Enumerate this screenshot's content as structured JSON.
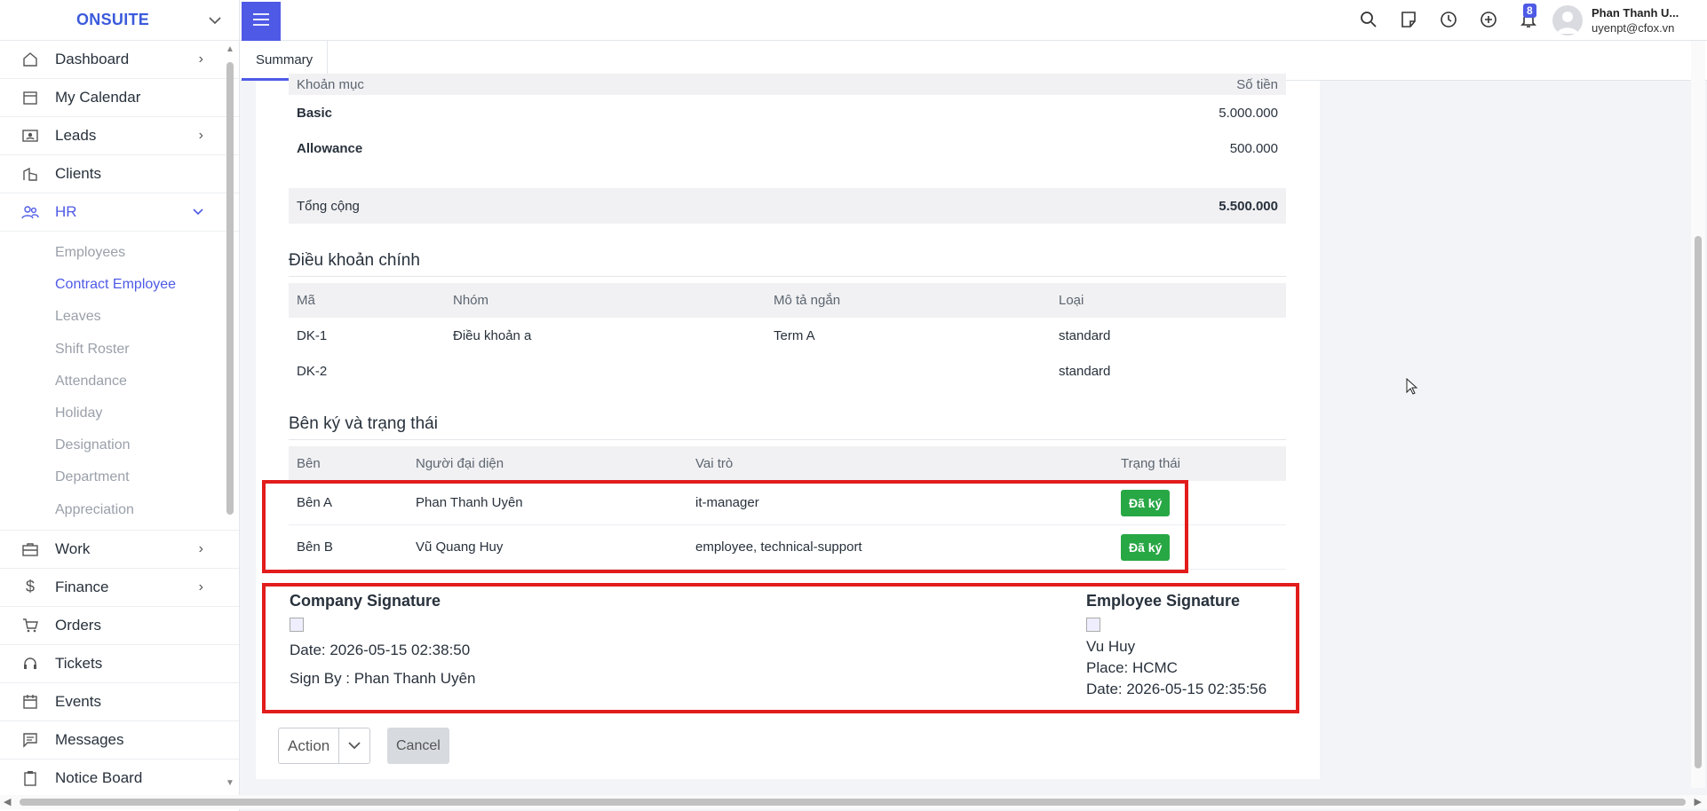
{
  "sidebar": {
    "brand": "ONSUITE",
    "items": [
      {
        "label": "Dashboard",
        "icon": "home-icon",
        "has_arrow": true
      },
      {
        "label": "My Calendar",
        "icon": "calendar-icon",
        "has_arrow": false
      },
      {
        "label": "Leads",
        "icon": "contact-card-icon",
        "has_arrow": true
      },
      {
        "label": "Clients",
        "icon": "building-icon",
        "has_arrow": false
      },
      {
        "label": "HR",
        "icon": "people-icon",
        "has_arrow": true,
        "expanded": true
      }
    ],
    "hr_submenu": [
      "Employees",
      "Contract Employee",
      "Leaves",
      "Shift Roster",
      "Attendance",
      "Holiday",
      "Designation",
      "Department",
      "Appreciation"
    ],
    "hr_active": "Contract Employee",
    "items_after": [
      {
        "label": "Work",
        "icon": "briefcase-icon",
        "has_arrow": true
      },
      {
        "label": "Finance",
        "icon": "dollar-icon",
        "has_arrow": true
      },
      {
        "label": "Orders",
        "icon": "cart-icon",
        "has_arrow": false
      },
      {
        "label": "Tickets",
        "icon": "headset-icon",
        "has_arrow": false
      },
      {
        "label": "Events",
        "icon": "calendar-event-icon",
        "has_arrow": false
      },
      {
        "label": "Messages",
        "icon": "message-icon",
        "has_arrow": false
      },
      {
        "label": "Notice Board",
        "icon": "clipboard-icon",
        "has_arrow": false
      }
    ]
  },
  "topbar": {
    "notification_count": "8",
    "user_name": "Phan Thanh U...",
    "user_email": "uyenpt@cfox.vn"
  },
  "tabs": {
    "summary": "Summary"
  },
  "salary": {
    "header_left": "Khoản mục",
    "header_right": "Số tiền",
    "rows": [
      {
        "label": "Basic",
        "amount": "5.000.000"
      },
      {
        "label": "Allowance",
        "amount": "500.000"
      }
    ],
    "total_label": "Tổng cộng",
    "total_amount": "5.500.000"
  },
  "terms": {
    "title": "Điều khoản chính",
    "headers": [
      "Mã",
      "Nhóm",
      "Mô tả ngắn",
      "Loại"
    ],
    "rows": [
      [
        "DK-1",
        "Điều khoản a",
        "Term A",
        "standard"
      ],
      [
        "DK-2",
        "",
        "",
        "standard"
      ]
    ]
  },
  "signers": {
    "title": "Bên ký và trạng thái",
    "headers": [
      "Bên",
      "Người đại diện",
      "Vai trò",
      "Trạng thái"
    ],
    "rows": [
      {
        "party": "Bên A",
        "rep": "Phan Thanh Uyên",
        "role": "it-manager",
        "status": "Đã ký"
      },
      {
        "party": "Bên B",
        "rep": "Vũ Quang Huy",
        "role": "employee, technical-support",
        "status": "Đã ký"
      }
    ],
    "status_color": "#28a745"
  },
  "signatures": {
    "company": {
      "title": "Company Signature",
      "date": "Date: 2026-05-15 02:38:50",
      "sign_by": "Sign By : Phan Thanh Uyên"
    },
    "employee": {
      "title": "Employee Signature",
      "name": "Vu Huy",
      "place": "Place: HCMC",
      "date": "Date: 2026-05-15 02:35:56"
    }
  },
  "actions": {
    "action_label": "Action",
    "cancel_label": "Cancel"
  },
  "colors": {
    "accent": "#4e5ae6",
    "highlight_box": "#e21c1c"
  }
}
